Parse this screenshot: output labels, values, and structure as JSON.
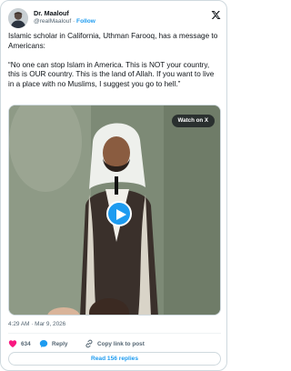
{
  "author": {
    "display_name": "Dr. Maalouf",
    "handle": "@realMaalouf",
    "separator": "·",
    "follow_label": "Follow"
  },
  "tweet": {
    "intro": "Islamic scholar in California, Uthman Farooq, has a message to Americans:",
    "quote": "“No one can stop Islam in America. This is NOT your country, this is OUR country. This is the land of Allah. If you want to live in a place with no Muslims, I suggest you go to hell.”"
  },
  "media": {
    "watch_label": "Watch on X",
    "icon": "play-icon"
  },
  "timestamp": "4:29 AM · Mar 9, 2026",
  "actions": {
    "like_count": "634",
    "reply_label": "Reply",
    "copy_label": "Copy link to post"
  },
  "footer": {
    "read_replies_label": "Read 156 replies"
  },
  "colors": {
    "accent": "#1d9bf0",
    "like": "#f91880",
    "text_primary": "#0f1419",
    "text_secondary": "#536471",
    "border": "#cfd9de"
  },
  "icons": [
    "avatar",
    "x-logo-icon",
    "play-icon",
    "heart-icon",
    "reply-icon",
    "link-icon"
  ]
}
